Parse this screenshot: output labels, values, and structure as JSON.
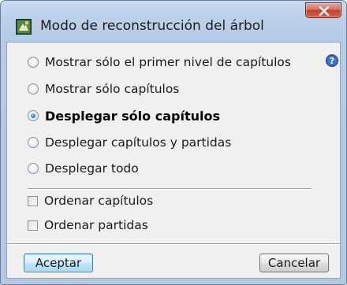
{
  "window": {
    "title": "Modo de reconstrucción del árbol",
    "close_icon": "close-icon",
    "app_icon": "tree-dialog-icon",
    "help_icon": "help-icon"
  },
  "options": [
    {
      "label": "Mostrar sólo el primer nivel de capítulos",
      "checked": false
    },
    {
      "label": "Mostrar sólo capítulos",
      "checked": false
    },
    {
      "label": "Desplegar sólo capítulos",
      "checked": true
    },
    {
      "label": "Desplegar capítulos y partidas",
      "checked": false
    },
    {
      "label": "Desplegar todo",
      "checked": false
    }
  ],
  "checkboxes": [
    {
      "label": "Ordenar capítulos",
      "checked": false
    },
    {
      "label": "Ordenar partidas",
      "checked": false
    }
  ],
  "buttons": {
    "ok": "Aceptar",
    "cancel": "Cancelar"
  },
  "colors": {
    "accent": "#2a7fd0",
    "close": "#c4412a"
  }
}
